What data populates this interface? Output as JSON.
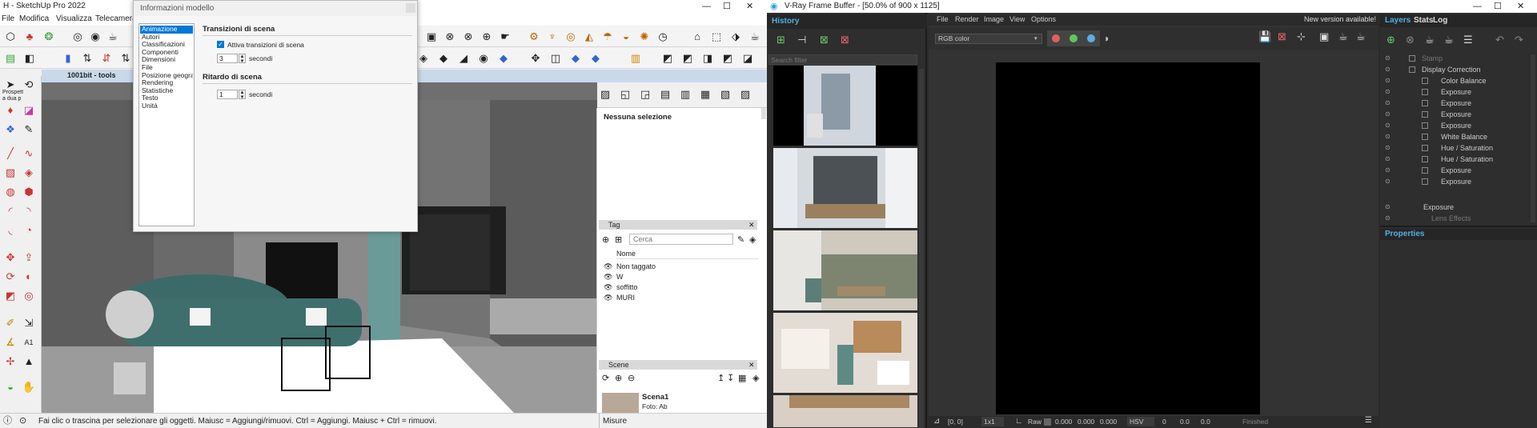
{
  "sketchup": {
    "title": "H - SketchUp Pro 2022",
    "menu": [
      "File",
      "Modifica",
      "Visualizza",
      "Telecamera"
    ],
    "tools_label": "1001bit - tools",
    "sidebar_stub": "Prospett\na dua p",
    "status_text": "Fai clic o trascina per selezionare gli oggetti. Maiusc = Aggiungi/rimuovi. Ctrl = Aggiungi. Maiusc + Ctrl = rimuovi.",
    "measure_label": "Misure"
  },
  "dialog": {
    "title": "Informazioni modello",
    "categories": [
      "Animazione",
      "Autori",
      "Classificazioni",
      "Componenti",
      "Dimensioni",
      "File",
      "Posizione geografica",
      "Rendering",
      "Statistiche",
      "Testo",
      "Unità"
    ],
    "selected_index": 0,
    "section1": "Transizioni di scena",
    "enable_label": "Attiva transizioni di scena",
    "enable_checked": true,
    "trans_value": "3",
    "trans_unit": "secondi",
    "section2": "Ritardo di scena",
    "delay_value": "1",
    "delay_unit": "secondi"
  },
  "entity": {
    "no_selection": "Nessuna selezione"
  },
  "tags": {
    "title": "Tag",
    "search_placeholder": "Cerca",
    "col_name": "Nome",
    "items": [
      "Non taggato",
      "W",
      "soffitto",
      "MURI"
    ]
  },
  "scenes": {
    "title": "Scene",
    "scene_name": "Scena1",
    "scene_sub": "Foto: Ab"
  },
  "vray": {
    "title": "V-Ray Frame Buffer - [50.0% of 900 x 1125]",
    "history_tab": "History",
    "search_placeholder": "Search filter",
    "menu": [
      "File",
      "Render",
      "Image",
      "View",
      "Options"
    ],
    "new_version": "New version available!",
    "channel": "RGB color",
    "layers_tabs": [
      "Layers",
      "Stats",
      "Log"
    ],
    "layers": [
      "Stamp",
      "Display Correction",
      "Color Balance",
      "Exposure",
      "Exposure",
      "Exposure",
      "Exposure",
      "White Balance",
      "Hue / Saturation",
      "Hue / Saturation",
      "Exposure",
      "Exposure",
      "Exposure",
      "Lens Effects"
    ],
    "properties": "Properties",
    "coords": "[0, 0]",
    "zoom": "1x1",
    "raw_label": "Raw",
    "raw_values": [
      "0.000",
      "0.000",
      "0.000"
    ],
    "colorspace": "HSV",
    "hsv_values": [
      "0",
      "0.0",
      "0.0"
    ],
    "status": "Finished",
    "colors": {
      "red": "#e06060",
      "green": "#5cc85c",
      "blue": "#5ab0e0",
      "accent": "#29a0e0"
    }
  }
}
